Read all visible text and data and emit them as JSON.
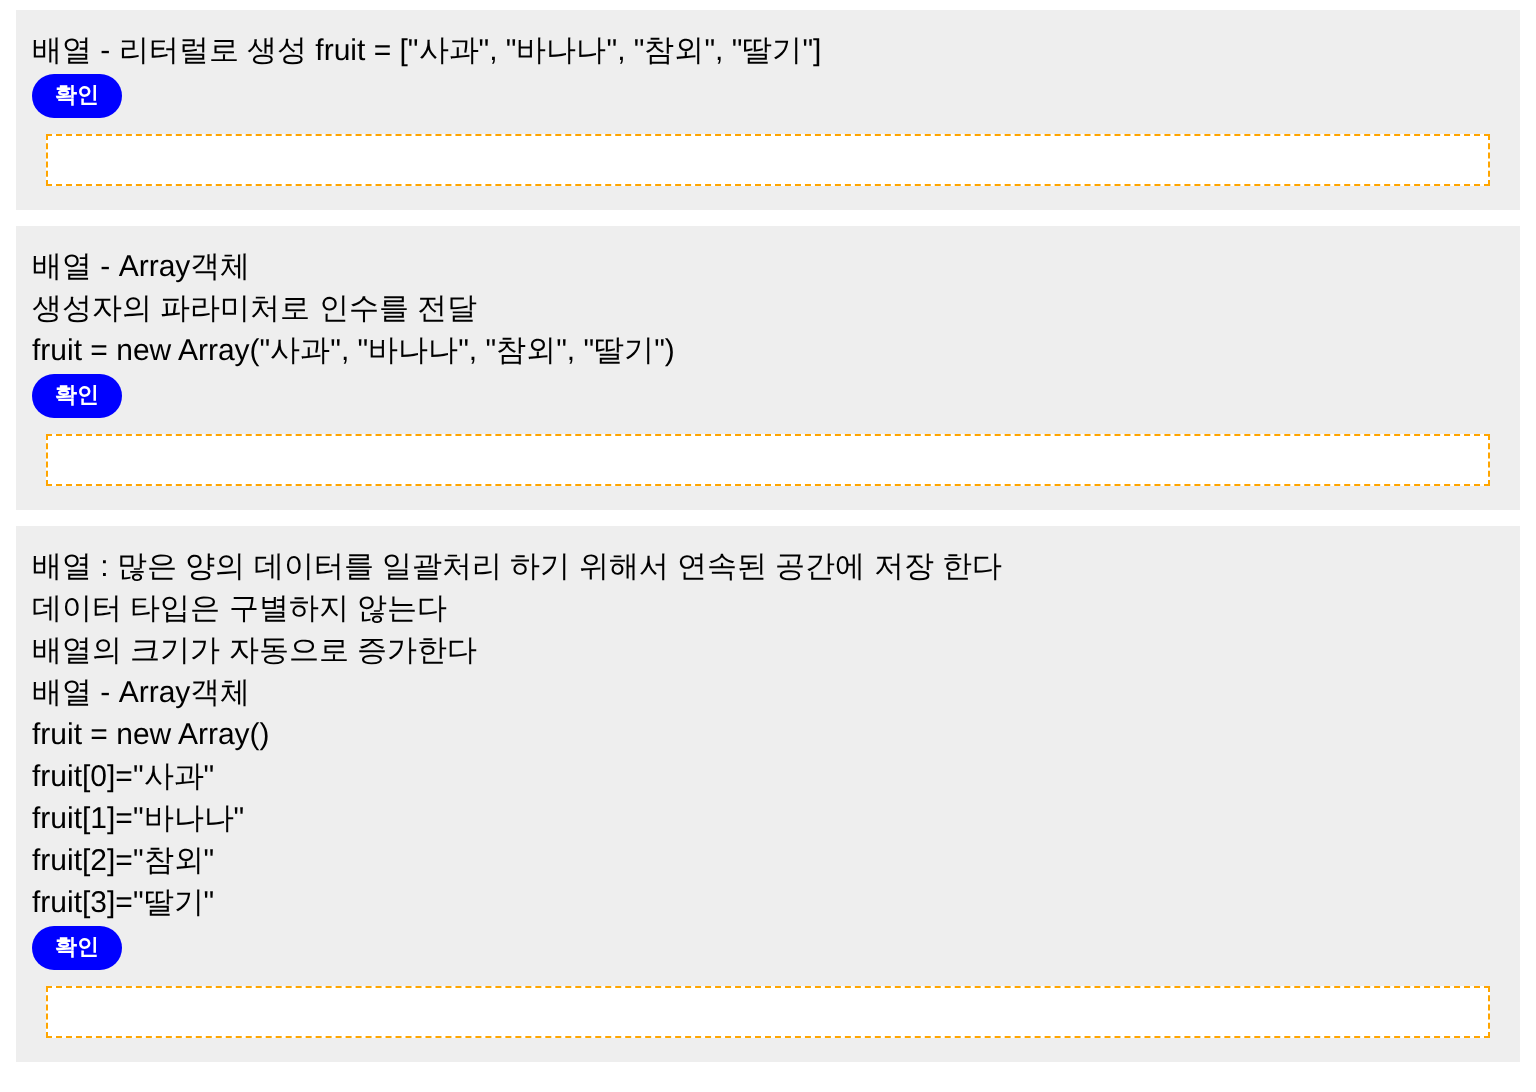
{
  "sections": [
    {
      "lines": [
        "배열 - 리터럴로 생성 fruit = [\"사과\", \"바나나\", \"참외\", \"딸기\"]"
      ],
      "button": "확인"
    },
    {
      "lines": [
        "배열 - Array객체",
        "생성자의 파라미처로 인수를 전달",
        "fruit = new Array(\"사과\", \"바나나\", \"참외\", \"딸기\")"
      ],
      "button": "확인"
    },
    {
      "lines": [
        "배열 : 많은 양의 데이터를 일괄처리 하기 위해서 연속된 공간에 저장 한다",
        "데이터 타입은 구별하지 않는다",
        "배열의 크기가 자동으로 증가한다",
        "배열 - Array객체",
        "fruit = new Array()",
        "fruit[0]=\"사과\"",
        "fruit[1]=\"바나나\"",
        "fruit[2]=\"참외\"",
        "fruit[3]=\"딸기\""
      ],
      "button": "확인"
    }
  ]
}
